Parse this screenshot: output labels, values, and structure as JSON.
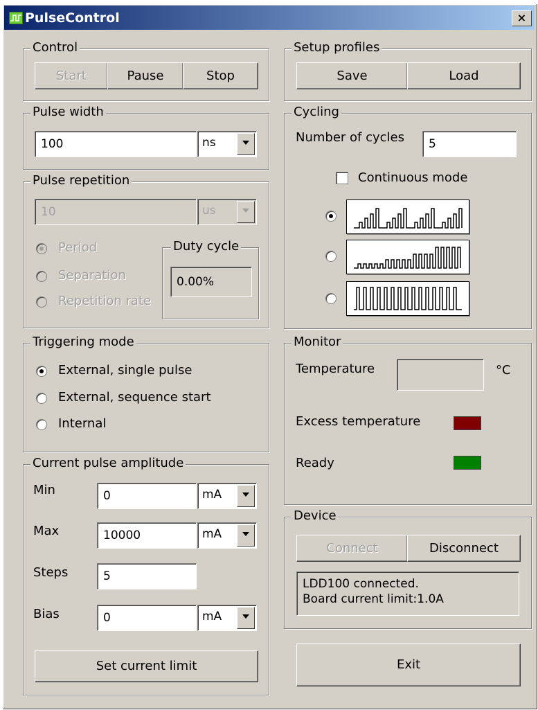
{
  "window": {
    "title": "PulseControl",
    "close_label": "×"
  },
  "control": {
    "legend": "Control",
    "start": "Start",
    "pause": "Pause",
    "stop": "Stop"
  },
  "setup_profiles": {
    "legend": "Setup profiles",
    "save": "Save",
    "load": "Load"
  },
  "pulse_width": {
    "legend": "Pulse width",
    "value": "100",
    "unit": "ns"
  },
  "cycling": {
    "legend": "Cycling",
    "cycles_label": "Number of cycles",
    "cycles_value": "5",
    "continuous_label": "Continuous mode",
    "continuous_checked": false,
    "selected_pattern": 0
  },
  "pulse_repetition": {
    "legend": "Pulse repetition",
    "value": "10",
    "unit": "us",
    "options": [
      "Period",
      "Separation",
      "Repetition rate"
    ],
    "selected": "Period",
    "duty_cycle_legend": "Duty cycle",
    "duty_cycle_value": "0.00%"
  },
  "triggering": {
    "legend": "Triggering mode",
    "options": [
      "External, single pulse",
      "External, sequence start",
      "Internal"
    ],
    "selected": "External, single pulse"
  },
  "monitor": {
    "legend": "Monitor",
    "temperature_label": "Temperature",
    "temperature_unit": "°C",
    "excess_label": "Excess temperature",
    "ready_label": "Ready",
    "excess_color": "#800000",
    "ready_color": "#008000"
  },
  "current": {
    "legend": "Current pulse amplitude",
    "min_label": "Min",
    "min_value": "0",
    "min_unit": "mA",
    "max_label": "Max",
    "max_value": "10000",
    "max_unit": "mA",
    "steps_label": "Steps",
    "steps_value": "5",
    "bias_label": "Bias",
    "bias_value": "0",
    "bias_unit": "mA",
    "set_limit": "Set current limit"
  },
  "device": {
    "legend": "Device",
    "connect": "Connect",
    "disconnect": "Disconnect",
    "status_line1": "LDD100 connected.",
    "status_line2": "Board current limit:1.0A"
  },
  "exit": "Exit"
}
